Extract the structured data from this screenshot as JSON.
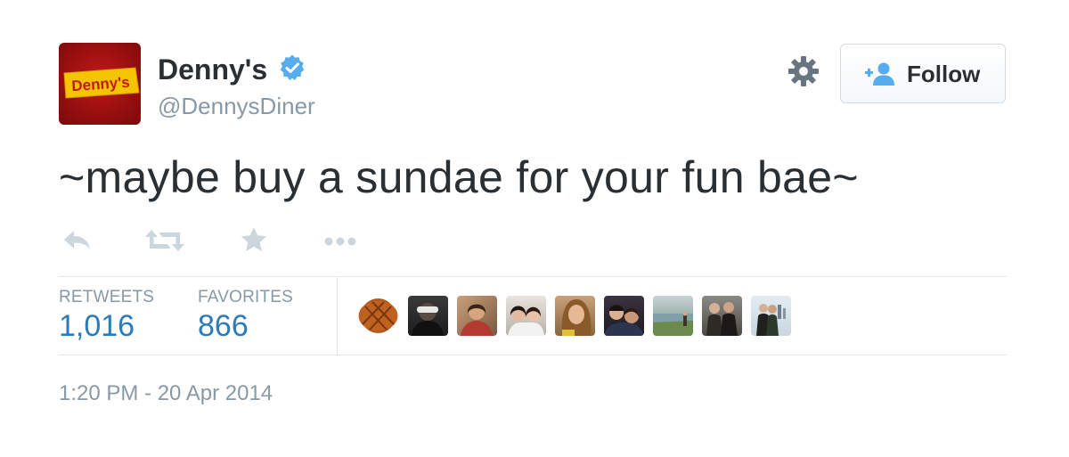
{
  "user": {
    "avatar_text": "Denny's",
    "display_name": "Denny's",
    "screen_name": "@DennysDiner",
    "verified": true
  },
  "header": {
    "settings_icon": "gear-icon",
    "follow_label": "Follow",
    "follow_icon": "add-user-icon"
  },
  "tweet": {
    "text": "~maybe buy a sundae for your fun bae~",
    "timestamp": "1:20 PM - 20 Apr 2014"
  },
  "actions": [
    "reply-icon",
    "retweet-icon",
    "favorite-icon",
    "more-icon"
  ],
  "stats": {
    "retweets_label": "RETWEETS",
    "retweets_value": "1,016",
    "favorites_label": "FAVORITES",
    "favorites_value": "866"
  },
  "favoriters_count_shown": 9,
  "colors": {
    "brand_red": "#c31a1a",
    "brand_yellow": "#f5c400",
    "link_blue": "#2b7bb9",
    "verified_blue": "#55acee",
    "muted_text": "#8899a6"
  }
}
